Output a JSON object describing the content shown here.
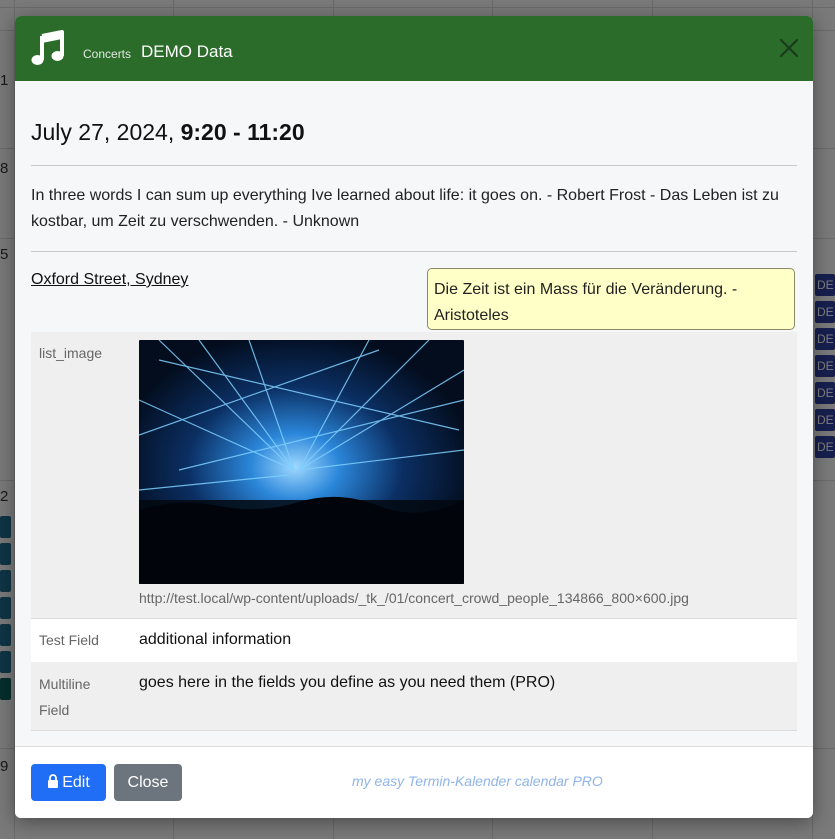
{
  "background": {
    "day_numbers": [
      "1",
      "8",
      "5",
      "2",
      "9"
    ],
    "chip_text": "DE"
  },
  "modal": {
    "category": "Concerts",
    "title": "DEMO Data",
    "date": "July 27, 2024,",
    "time": "9:20 - 11:20",
    "description": "In three words I can sum up everything Ive learned about life: it goes on. - Robert Frost - Das Leben ist zu kostbar, um Zeit zu verschwenden. - Unknown",
    "location": "Oxford Street, Sydney",
    "tooltip": "Die Zeit ist ein Mass für die Veränderung. - Aristoteles",
    "fields": [
      {
        "label": "list_image",
        "url": "http://test.local/wp-content/uploads/_tk_/01/concert_crowd_people_134866_800×600.jpg"
      },
      {
        "label": "Test Field",
        "value": "additional information"
      },
      {
        "label": "Multiline Field",
        "value": "goes here in the fields you define as you need them (PRO)"
      }
    ],
    "footer": {
      "edit_label": "Edit",
      "close_label": "Close",
      "brand": "my easy Termin-Kalender calendar PRO"
    }
  },
  "colors": {
    "header": "#2b6c2b",
    "edit_button": "#1f6ef5",
    "close_button": "#6c757d",
    "tooltip_bg": "#ffffc8",
    "brand_text": "#8fb4ea"
  }
}
